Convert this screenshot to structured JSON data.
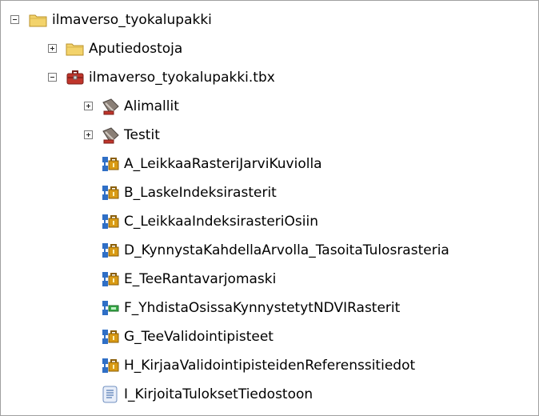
{
  "tree": {
    "root": {
      "label": "ilmaverso_tyokalupakki",
      "icon": "folder-icon",
      "expanded": true
    },
    "children": [
      {
        "label": "Aputiedostoja",
        "icon": "folder-icon",
        "expanded": false
      },
      {
        "label": "ilmaverso_tyokalupakki.tbx",
        "icon": "toolbox-icon",
        "expanded": true
      }
    ],
    "toolbox_items": [
      {
        "label": "Alimallit",
        "icon": "toolset-icon",
        "expanded": false
      },
      {
        "label": "Testit",
        "icon": "toolset-icon",
        "expanded": false
      },
      {
        "label": "A_LeikkaaRasteriJarviKuviolla",
        "icon": "model-tool-icon"
      },
      {
        "label": "B_LaskeIndeksirasterit",
        "icon": "model-tool-icon"
      },
      {
        "label": "C_LeikkaaIndeksirasteriOsiin",
        "icon": "model-tool-icon"
      },
      {
        "label": "D_KynnystaKahdellaArvolla_TasoitaTulosrasteria",
        "icon": "model-tool-icon"
      },
      {
        "label": "E_TeeRantavarjomaski",
        "icon": "model-tool-icon"
      },
      {
        "label": "F_YhdistaOsissaKynnystetytNDVIRasterit",
        "icon": "model-tool-icon-green"
      },
      {
        "label": "G_TeeValidointipisteet",
        "icon": "model-tool-icon"
      },
      {
        "label": "H_KirjaaValidointipisteidenReferenssitiedot",
        "icon": "model-tool-icon"
      },
      {
        "label": "I_KirjoitaTuloksetTiedostoon",
        "icon": "script-tool-icon"
      }
    ]
  },
  "colors": {
    "folder": "#f3d36b",
    "folder_edge": "#b9912a",
    "toolbox_red": "#c0352b",
    "toolset": "#8a7f76",
    "model_lock": "#d99a14",
    "model_lock_green": "#35a845",
    "model_box": "#2f6fc6",
    "script": "#6f8fc0"
  }
}
